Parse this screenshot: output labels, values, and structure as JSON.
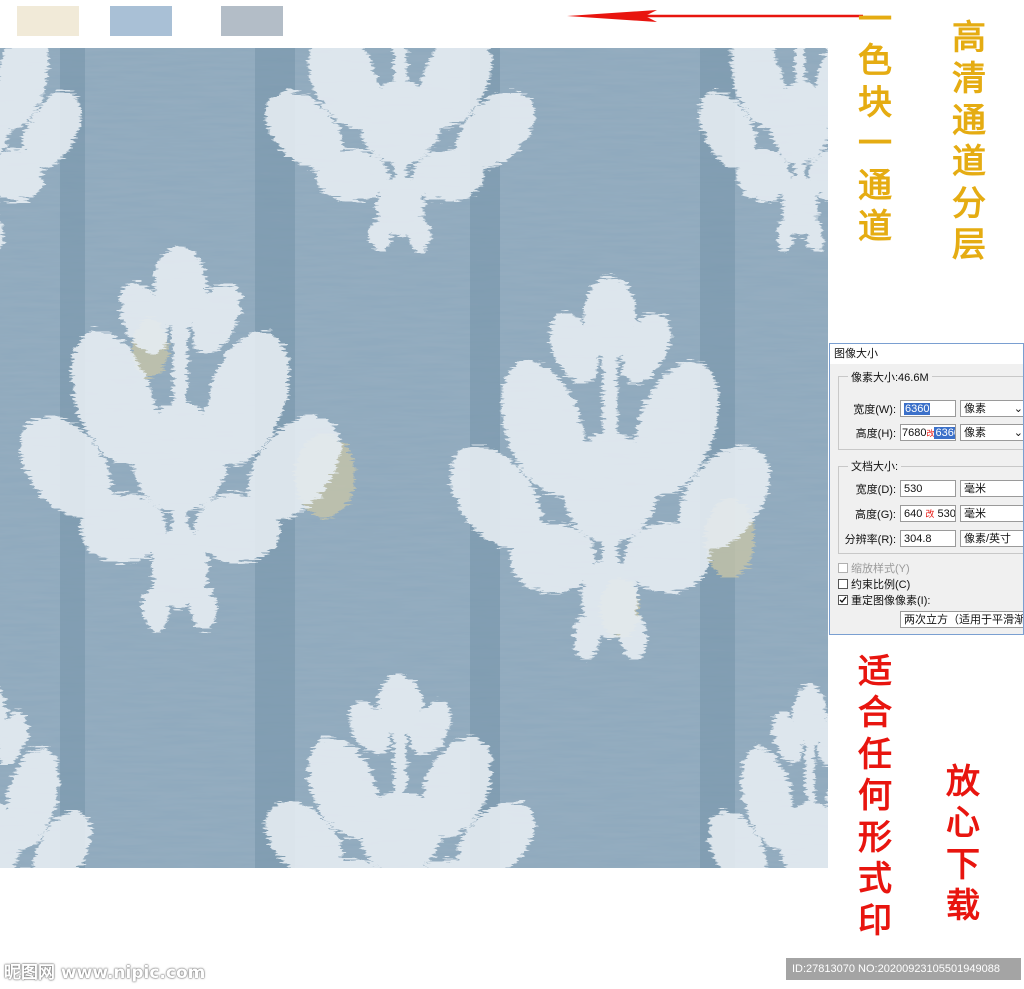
{
  "swatches": [
    {
      "name": "cream",
      "color": "#f1ead8"
    },
    {
      "name": "light-blue",
      "color": "#a9c0d6"
    },
    {
      "name": "grey-blue",
      "color": "#b3bdc7"
    }
  ],
  "colors": {
    "pattern_bg": "#8ea9bd",
    "pattern_dark": "#6f8da3",
    "motif": "#e6edf2",
    "accent_beige": "#c9c6a8",
    "arrow": "#e8150f",
    "yellow_text": "#e5ac12",
    "red_text": "#e8150f"
  },
  "pattern": {
    "icon": "damask-ikat-pattern"
  },
  "captions": {
    "col1": [
      "一",
      "色",
      "块",
      "一",
      "通",
      "道"
    ],
    "col2": [
      "高",
      "清",
      "通",
      "道",
      "分",
      "层"
    ],
    "col3": [
      "适",
      "合",
      "任",
      "何",
      "形",
      "式",
      "印"
    ],
    "col4": [
      "放",
      "心",
      "下",
      "载"
    ]
  },
  "dialog": {
    "title": "图像大小",
    "pixel_group_label": "像素大小:46.6M",
    "width_label": "宽度(W):",
    "width_value": "6360",
    "width_unit": "像素",
    "height_label": "高度(H):",
    "height_value_old": "7680",
    "height_mark": "改",
    "height_value_new": "6360",
    "height_unit": "像素",
    "doc_group_label": "文档大小:",
    "doc_width_label": "宽度(D):",
    "doc_width_value": "530",
    "doc_width_unit": "毫米",
    "doc_height_label": "高度(G):",
    "doc_height_value_old": "640",
    "doc_height_mark": "改",
    "doc_height_value_new": "530",
    "doc_height_unit": "毫米",
    "resolution_label": "分辨率(R):",
    "resolution_value": "304.8",
    "resolution_unit": "像素/英寸",
    "scale_styles_label": "缩放样式(Y)",
    "constrain_label": "约束比例(C)",
    "resample_label": "重定图像像素(I):",
    "resample_method": "两次立方（适用于平滑渐变"
  },
  "watermark": {
    "left": "昵图网 www.nipic.com",
    "right": "ID:27813070 NO:20200923105501949088"
  }
}
